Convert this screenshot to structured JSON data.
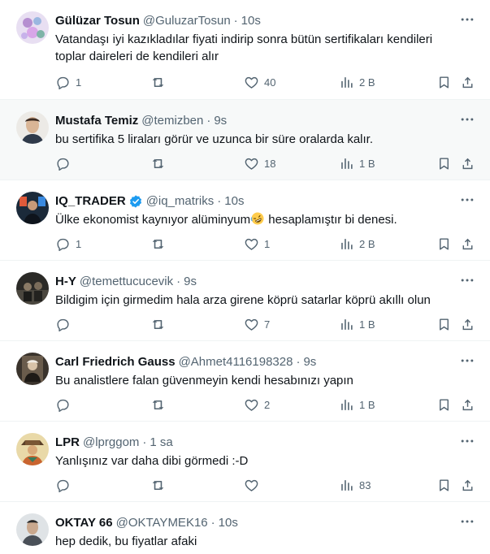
{
  "tweets": [
    {
      "name": "Gülüzar Tosun",
      "handle": "@GuluzarTosun",
      "time": "10s",
      "lines": [
        "Vatandaşı  iyi kazıkladılar  fiyati indirip sonra bütün sertifikaları kendileri",
        "toplar daireleri de kendileri alır"
      ],
      "replies": "1",
      "retweets": "",
      "likes": "40",
      "views": "2 B",
      "avatar_color": "#b58fd0"
    },
    {
      "name": "Mustafa Temiz",
      "handle": "@temizben",
      "time": "9s",
      "lines": [
        "bu sertifika 5 liraları görür ve uzunca bir süre oralarda kalır."
      ],
      "replies": "",
      "retweets": "",
      "likes": "18",
      "views": "1 B",
      "avatar_color": "#d9c3b0"
    },
    {
      "name": "IQ_TRADER",
      "handle": "@iq_matriks",
      "time": "10s",
      "verified": true,
      "text_before_emoji": "Ülke ekonomist kaynıyor alüminyum",
      "text_after_emoji": " hesaplamıştır bi denesi.",
      "replies": "1",
      "retweets": "",
      "likes": "1",
      "views": "2 B",
      "avatar_color": "#1b2a3a"
    },
    {
      "name": "H-Y",
      "handle": "@temettucucevik",
      "time": "9s",
      "lines": [
        "Bildigim için girmedim hala arza girene köprü satarlar köprü akıllı olun"
      ],
      "replies": "",
      "retweets": "",
      "likes": "7",
      "views": "1 B",
      "avatar_color": "#3a3a36"
    },
    {
      "name": "Carl Friedrich Gauss",
      "handle": "@Ahmet4116198328",
      "time": "9s",
      "lines": [
        "Bu analistlere falan güvenmeyin kendi hesabınızı yapın"
      ],
      "replies": "",
      "retweets": "",
      "likes": "2",
      "views": "1 B",
      "avatar_color": "#4a3f35"
    },
    {
      "name": "LPR",
      "handle": "@lprggom",
      "time": "1 sa",
      "lines": [
        "Yanlışınız var daha dibi görmedi :-D"
      ],
      "replies": "",
      "retweets": "",
      "likes": "",
      "views": "83",
      "avatar_color": "#c9a24a"
    },
    {
      "name": "OKTAY 66",
      "handle": "@OKTAYMEK16",
      "time": "10s",
      "lines": [
        "hep dedik, bu fiyatlar afaki"
      ],
      "avatar_color": "#8a8f94"
    }
  ],
  "colors": {
    "muted": "#536471",
    "text": "#0f1419",
    "verified": "#1d9bf0",
    "divider": "#eff3f4"
  }
}
